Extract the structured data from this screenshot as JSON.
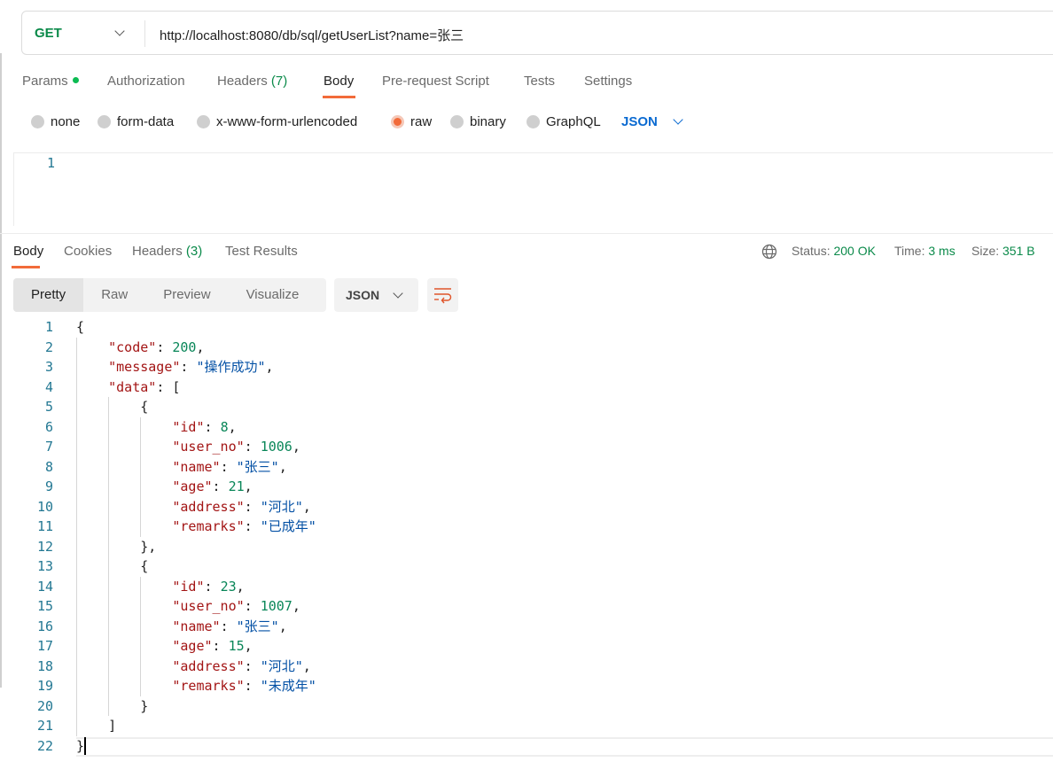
{
  "request": {
    "method": "GET",
    "url": "http://localhost:8080/db/sql/getUserList?name=张三"
  },
  "request_tabs": [
    {
      "label": "Params"
    },
    {
      "label": "Authorization"
    },
    {
      "label": "Headers",
      "count": "(7)"
    },
    {
      "label": "Body",
      "active": true
    },
    {
      "label": "Pre-request Script"
    },
    {
      "label": "Tests"
    },
    {
      "label": "Settings"
    }
  ],
  "body_types": [
    {
      "label": "none"
    },
    {
      "label": "form-data"
    },
    {
      "label": "x-www-form-urlencoded"
    },
    {
      "label": "raw",
      "selected": true
    },
    {
      "label": "binary"
    },
    {
      "label": "GraphQL"
    }
  ],
  "body_format": "JSON",
  "request_body": {
    "line_numbers": [
      "1"
    ]
  },
  "response_tabs": [
    {
      "label": "Body",
      "active": true
    },
    {
      "label": "Cookies"
    },
    {
      "label": "Headers",
      "count": "(3)"
    },
    {
      "label": "Test Results"
    }
  ],
  "response_status": {
    "status_label": "Status:",
    "status": "200 OK",
    "time_label": "Time:",
    "time": "3 ms",
    "size_label": "Size:",
    "size": "351 B"
  },
  "view_modes": [
    {
      "label": "Pretty",
      "active": true
    },
    {
      "label": "Raw"
    },
    {
      "label": "Preview"
    },
    {
      "label": "Visualize"
    }
  ],
  "response_format": "JSON",
  "colors": {
    "accent": "#f26b3a",
    "success": "#0b8a4a",
    "key": "#a31515",
    "number": "#098658",
    "string": "#0451a5"
  },
  "icons": {
    "globe": "globe-icon",
    "wrap": "wrap-lines-icon"
  },
  "response_code": [
    [
      [
        "p",
        "{"
      ]
    ],
    [
      [
        "p",
        "    "
      ],
      [
        "k",
        "\"code\""
      ],
      [
        "p",
        ": "
      ],
      [
        "n",
        "200"
      ],
      [
        "p",
        ","
      ]
    ],
    [
      [
        "p",
        "    "
      ],
      [
        "k",
        "\"message\""
      ],
      [
        "p",
        ": "
      ],
      [
        "s",
        "\"操作成功\""
      ],
      [
        "p",
        ","
      ]
    ],
    [
      [
        "p",
        "    "
      ],
      [
        "k",
        "\"data\""
      ],
      [
        "p",
        ": ["
      ]
    ],
    [
      [
        "p",
        "        {"
      ]
    ],
    [
      [
        "p",
        "            "
      ],
      [
        "k",
        "\"id\""
      ],
      [
        "p",
        ": "
      ],
      [
        "n",
        "8"
      ],
      [
        "p",
        ","
      ]
    ],
    [
      [
        "p",
        "            "
      ],
      [
        "k",
        "\"user_no\""
      ],
      [
        "p",
        ": "
      ],
      [
        "n",
        "1006"
      ],
      [
        "p",
        ","
      ]
    ],
    [
      [
        "p",
        "            "
      ],
      [
        "k",
        "\"name\""
      ],
      [
        "p",
        ": "
      ],
      [
        "s",
        "\"张三\""
      ],
      [
        "p",
        ","
      ]
    ],
    [
      [
        "p",
        "            "
      ],
      [
        "k",
        "\"age\""
      ],
      [
        "p",
        ": "
      ],
      [
        "n",
        "21"
      ],
      [
        "p",
        ","
      ]
    ],
    [
      [
        "p",
        "            "
      ],
      [
        "k",
        "\"address\""
      ],
      [
        "p",
        ": "
      ],
      [
        "s",
        "\"河北\""
      ],
      [
        "p",
        ","
      ]
    ],
    [
      [
        "p",
        "            "
      ],
      [
        "k",
        "\"remarks\""
      ],
      [
        "p",
        ": "
      ],
      [
        "s",
        "\"已成年\""
      ]
    ],
    [
      [
        "p",
        "        },"
      ]
    ],
    [
      [
        "p",
        "        {"
      ]
    ],
    [
      [
        "p",
        "            "
      ],
      [
        "k",
        "\"id\""
      ],
      [
        "p",
        ": "
      ],
      [
        "n",
        "23"
      ],
      [
        "p",
        ","
      ]
    ],
    [
      [
        "p",
        "            "
      ],
      [
        "k",
        "\"user_no\""
      ],
      [
        "p",
        ": "
      ],
      [
        "n",
        "1007"
      ],
      [
        "p",
        ","
      ]
    ],
    [
      [
        "p",
        "            "
      ],
      [
        "k",
        "\"name\""
      ],
      [
        "p",
        ": "
      ],
      [
        "s",
        "\"张三\""
      ],
      [
        "p",
        ","
      ]
    ],
    [
      [
        "p",
        "            "
      ],
      [
        "k",
        "\"age\""
      ],
      [
        "p",
        ": "
      ],
      [
        "n",
        "15"
      ],
      [
        "p",
        ","
      ]
    ],
    [
      [
        "p",
        "            "
      ],
      [
        "k",
        "\"address\""
      ],
      [
        "p",
        ": "
      ],
      [
        "s",
        "\"河北\""
      ],
      [
        "p",
        ","
      ]
    ],
    [
      [
        "p",
        "            "
      ],
      [
        "k",
        "\"remarks\""
      ],
      [
        "p",
        ": "
      ],
      [
        "s",
        "\"未成年\""
      ]
    ],
    [
      [
        "p",
        "        }"
      ]
    ],
    [
      [
        "p",
        "    ]"
      ]
    ],
    [
      [
        "p",
        "}"
      ]
    ]
  ]
}
